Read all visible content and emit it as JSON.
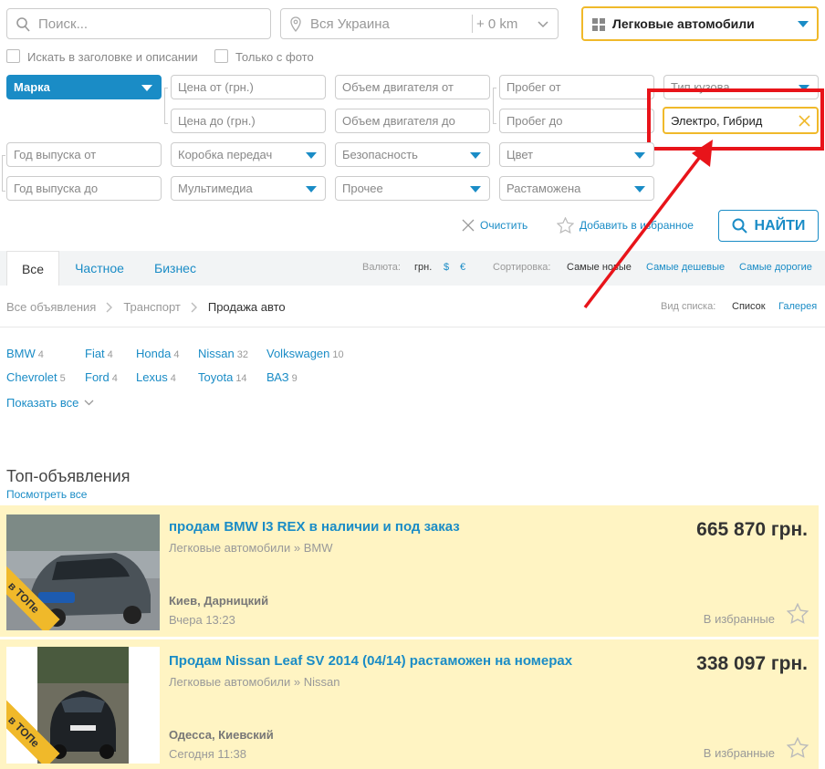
{
  "search": {
    "placeholder": "Поиск...",
    "location": "Вся Украина",
    "radius": "+ 0 km",
    "category": "Легковые автомобили"
  },
  "checks": {
    "title_desc": "Искать в заголовке и описании",
    "with_photo": "Только с фото"
  },
  "filters": {
    "brand": "Марка",
    "price_from": "Цена от (грн.)",
    "price_to": "Цена до (грн.)",
    "engine_from": "Объем двигателя от",
    "engine_to": "Объем двигателя до",
    "mileage_from": "Пробег от",
    "mileage_to": "Пробег до",
    "body_type": "Тип кузова",
    "fuel": "Электро, Гибрид",
    "year_from": "Год выпуска от",
    "year_to": "Год выпуска до",
    "gearbox": "Коробка передач",
    "safety": "Безопасность",
    "color": "Цвет",
    "multimedia": "Мультимедиа",
    "other": "Прочее",
    "customs": "Растаможена"
  },
  "actions": {
    "clear": "Очистить",
    "add_fav": "Добавить в избранное",
    "find": "НАЙТИ"
  },
  "tabs": [
    "Все",
    "Частное",
    "Бизнес"
  ],
  "currency": {
    "label": "Валюта:",
    "uah": "грн.",
    "usd": "$",
    "eur": "€"
  },
  "sorting": {
    "label": "Сортировка:",
    "new": "Самые новые",
    "cheap": "Самые дешевые",
    "expensive": "Самые дорогие"
  },
  "breadcrumb": [
    "Все объявления",
    "Транспорт",
    "Продажа авто"
  ],
  "view": {
    "label": "Вид списка:",
    "list": "Список",
    "gallery": "Галерея"
  },
  "brands": [
    {
      "name": "BMW",
      "count": "4"
    },
    {
      "name": "Fiat",
      "count": "4"
    },
    {
      "name": "Honda",
      "count": "4"
    },
    {
      "name": "Nissan",
      "count": "32"
    },
    {
      "name": "Volkswagen",
      "count": "10"
    },
    {
      "name": "Chevrolet",
      "count": "5"
    },
    {
      "name": "Ford",
      "count": "4"
    },
    {
      "name": "Lexus",
      "count": "4"
    },
    {
      "name": "Toyota",
      "count": "14"
    },
    {
      "name": "ВАЗ",
      "count": "9"
    }
  ],
  "show_all": "Показать все",
  "top": {
    "heading": "Топ-объявления",
    "see_all": "Посмотреть все"
  },
  "listings": [
    {
      "title": "продам BMW I3 REX в наличии и под заказ",
      "category": "Легковые автомобили » BMW",
      "price": "665 870 грн.",
      "location": "Киев, Дарницкий",
      "time": "Вчера 13:23",
      "fav": "В избранные",
      "badge": "в ТОПе"
    },
    {
      "title": "Продам Nissan Leaf SV 2014 (04/14) растаможен на номерах",
      "category": "Легковые автомобили » Nissan",
      "price": "338 097 грн.",
      "location": "Одесса, Киевский",
      "time": "Сегодня 11:38",
      "fav": "В избранные",
      "badge": "в ТОПе"
    }
  ],
  "colors": {
    "accent": "#1a8cc6",
    "highlight": "#f0b92a",
    "annotation": "#e8141a",
    "card_bg": "#fff4c3"
  }
}
